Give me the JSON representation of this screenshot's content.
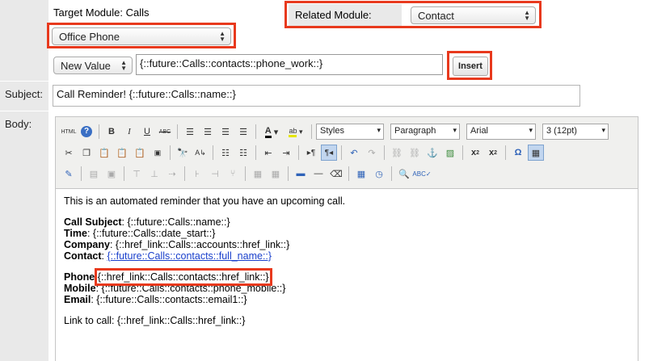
{
  "target_module": {
    "label": "Target Module: Calls"
  },
  "field_select": {
    "value": "Office Phone"
  },
  "related_module": {
    "label": "Related Module:",
    "value": "Contact"
  },
  "value_type": {
    "value": "New Value"
  },
  "variable_input": {
    "value": "{::future::Calls::contacts::phone_work::}"
  },
  "insert_button": {
    "label": "Insert"
  },
  "subject": {
    "label": "Subject:",
    "value": "Call Reminder! {::future::Calls::name::}"
  },
  "body": {
    "label": "Body:"
  },
  "toolbar": {
    "styles": "Styles",
    "paragraph": "Paragraph",
    "font": "Arial",
    "size": "3 (12pt)"
  },
  "email_body": {
    "intro": "This is an automated reminder that you have an upcoming call.",
    "call_subject_label": "Call Subject",
    "call_subject_value": ": {::future::Calls::name::}",
    "time_label": "Time",
    "time_value": ": {::future::Calls::date_start::}",
    "company_label": "Company",
    "company_value": ": {::href_link::Calls::accounts::href_link::}",
    "contact_label": "Contact",
    "contact_sep": ": ",
    "contact_value": "{::future::Calls::contacts::full_name::}",
    "phone_label": "Phone",
    "phone_sep": ":",
    "phone_value": "{::href_link::Calls::contacts::href_link::}",
    "mobile_label": "Mobile",
    "mobile_value": ": {::future::Calls::contacts::phone_mobile::}",
    "email_label": "Email",
    "email_value": ": {::future::Calls::contacts::email1::}",
    "link_line": "Link to call: {::href_link::Calls::href_link::}"
  },
  "colors": {
    "highlight": "#e8391d",
    "label_bg": "#e9e9e9",
    "link": "#1a40cc"
  }
}
